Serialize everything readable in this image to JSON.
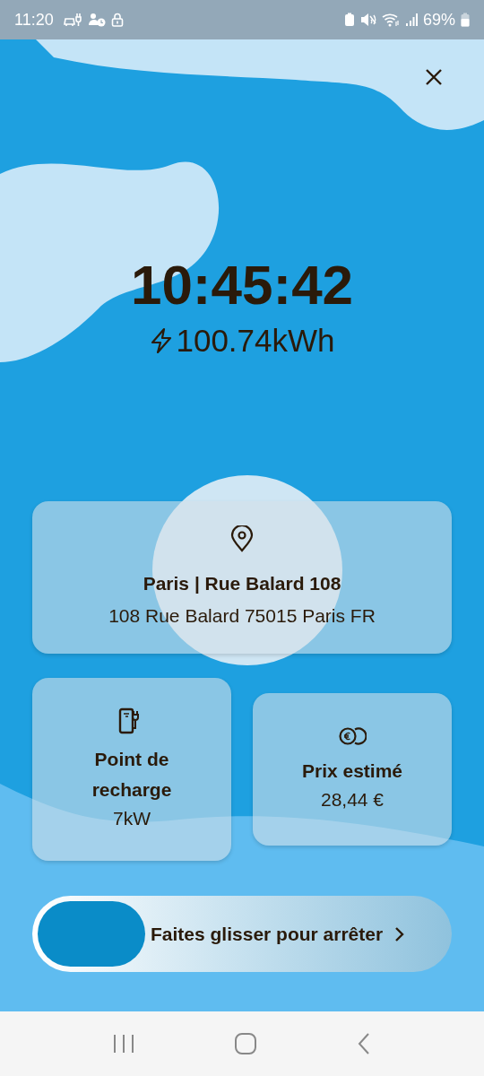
{
  "status_bar": {
    "time": "11:20",
    "battery": "69%"
  },
  "session": {
    "duration": "10:45:42",
    "energy": "100.74kWh"
  },
  "location": {
    "name": "Paris | Rue Balard 108",
    "address": "108 Rue Balard 75015 Paris FR"
  },
  "info_cards": [
    {
      "kind": "charger",
      "title": "Point de recharge",
      "value": "7kW"
    },
    {
      "kind": "price",
      "title": "Prix estimé",
      "value": "28,44 €"
    }
  ],
  "slider": {
    "label": "Faites glisser pour arrêter",
    "level": 0
  }
}
